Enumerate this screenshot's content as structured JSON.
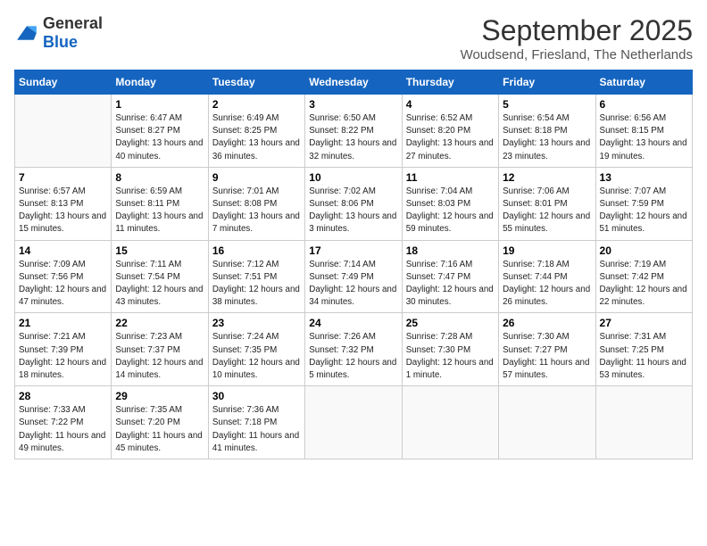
{
  "logo": {
    "text_general": "General",
    "text_blue": "Blue"
  },
  "title": "September 2025",
  "location": "Woudsend, Friesland, The Netherlands",
  "days_of_week": [
    "Sunday",
    "Monday",
    "Tuesday",
    "Wednesday",
    "Thursday",
    "Friday",
    "Saturday"
  ],
  "weeks": [
    [
      {
        "day": "",
        "sunrise": "",
        "sunset": "",
        "daylight": ""
      },
      {
        "day": "1",
        "sunrise": "Sunrise: 6:47 AM",
        "sunset": "Sunset: 8:27 PM",
        "daylight": "Daylight: 13 hours and 40 minutes."
      },
      {
        "day": "2",
        "sunrise": "Sunrise: 6:49 AM",
        "sunset": "Sunset: 8:25 PM",
        "daylight": "Daylight: 13 hours and 36 minutes."
      },
      {
        "day": "3",
        "sunrise": "Sunrise: 6:50 AM",
        "sunset": "Sunset: 8:22 PM",
        "daylight": "Daylight: 13 hours and 32 minutes."
      },
      {
        "day": "4",
        "sunrise": "Sunrise: 6:52 AM",
        "sunset": "Sunset: 8:20 PM",
        "daylight": "Daylight: 13 hours and 27 minutes."
      },
      {
        "day": "5",
        "sunrise": "Sunrise: 6:54 AM",
        "sunset": "Sunset: 8:18 PM",
        "daylight": "Daylight: 13 hours and 23 minutes."
      },
      {
        "day": "6",
        "sunrise": "Sunrise: 6:56 AM",
        "sunset": "Sunset: 8:15 PM",
        "daylight": "Daylight: 13 hours and 19 minutes."
      }
    ],
    [
      {
        "day": "7",
        "sunrise": "Sunrise: 6:57 AM",
        "sunset": "Sunset: 8:13 PM",
        "daylight": "Daylight: 13 hours and 15 minutes."
      },
      {
        "day": "8",
        "sunrise": "Sunrise: 6:59 AM",
        "sunset": "Sunset: 8:11 PM",
        "daylight": "Daylight: 13 hours and 11 minutes."
      },
      {
        "day": "9",
        "sunrise": "Sunrise: 7:01 AM",
        "sunset": "Sunset: 8:08 PM",
        "daylight": "Daylight: 13 hours and 7 minutes."
      },
      {
        "day": "10",
        "sunrise": "Sunrise: 7:02 AM",
        "sunset": "Sunset: 8:06 PM",
        "daylight": "Daylight: 13 hours and 3 minutes."
      },
      {
        "day": "11",
        "sunrise": "Sunrise: 7:04 AM",
        "sunset": "Sunset: 8:03 PM",
        "daylight": "Daylight: 12 hours and 59 minutes."
      },
      {
        "day": "12",
        "sunrise": "Sunrise: 7:06 AM",
        "sunset": "Sunset: 8:01 PM",
        "daylight": "Daylight: 12 hours and 55 minutes."
      },
      {
        "day": "13",
        "sunrise": "Sunrise: 7:07 AM",
        "sunset": "Sunset: 7:59 PM",
        "daylight": "Daylight: 12 hours and 51 minutes."
      }
    ],
    [
      {
        "day": "14",
        "sunrise": "Sunrise: 7:09 AM",
        "sunset": "Sunset: 7:56 PM",
        "daylight": "Daylight: 12 hours and 47 minutes."
      },
      {
        "day": "15",
        "sunrise": "Sunrise: 7:11 AM",
        "sunset": "Sunset: 7:54 PM",
        "daylight": "Daylight: 12 hours and 43 minutes."
      },
      {
        "day": "16",
        "sunrise": "Sunrise: 7:12 AM",
        "sunset": "Sunset: 7:51 PM",
        "daylight": "Daylight: 12 hours and 38 minutes."
      },
      {
        "day": "17",
        "sunrise": "Sunrise: 7:14 AM",
        "sunset": "Sunset: 7:49 PM",
        "daylight": "Daylight: 12 hours and 34 minutes."
      },
      {
        "day": "18",
        "sunrise": "Sunrise: 7:16 AM",
        "sunset": "Sunset: 7:47 PM",
        "daylight": "Daylight: 12 hours and 30 minutes."
      },
      {
        "day": "19",
        "sunrise": "Sunrise: 7:18 AM",
        "sunset": "Sunset: 7:44 PM",
        "daylight": "Daylight: 12 hours and 26 minutes."
      },
      {
        "day": "20",
        "sunrise": "Sunrise: 7:19 AM",
        "sunset": "Sunset: 7:42 PM",
        "daylight": "Daylight: 12 hours and 22 minutes."
      }
    ],
    [
      {
        "day": "21",
        "sunrise": "Sunrise: 7:21 AM",
        "sunset": "Sunset: 7:39 PM",
        "daylight": "Daylight: 12 hours and 18 minutes."
      },
      {
        "day": "22",
        "sunrise": "Sunrise: 7:23 AM",
        "sunset": "Sunset: 7:37 PM",
        "daylight": "Daylight: 12 hours and 14 minutes."
      },
      {
        "day": "23",
        "sunrise": "Sunrise: 7:24 AM",
        "sunset": "Sunset: 7:35 PM",
        "daylight": "Daylight: 12 hours and 10 minutes."
      },
      {
        "day": "24",
        "sunrise": "Sunrise: 7:26 AM",
        "sunset": "Sunset: 7:32 PM",
        "daylight": "Daylight: 12 hours and 5 minutes."
      },
      {
        "day": "25",
        "sunrise": "Sunrise: 7:28 AM",
        "sunset": "Sunset: 7:30 PM",
        "daylight": "Daylight: 12 hours and 1 minute."
      },
      {
        "day": "26",
        "sunrise": "Sunrise: 7:30 AM",
        "sunset": "Sunset: 7:27 PM",
        "daylight": "Daylight: 11 hours and 57 minutes."
      },
      {
        "day": "27",
        "sunrise": "Sunrise: 7:31 AM",
        "sunset": "Sunset: 7:25 PM",
        "daylight": "Daylight: 11 hours and 53 minutes."
      }
    ],
    [
      {
        "day": "28",
        "sunrise": "Sunrise: 7:33 AM",
        "sunset": "Sunset: 7:22 PM",
        "daylight": "Daylight: 11 hours and 49 minutes."
      },
      {
        "day": "29",
        "sunrise": "Sunrise: 7:35 AM",
        "sunset": "Sunset: 7:20 PM",
        "daylight": "Daylight: 11 hours and 45 minutes."
      },
      {
        "day": "30",
        "sunrise": "Sunrise: 7:36 AM",
        "sunset": "Sunset: 7:18 PM",
        "daylight": "Daylight: 11 hours and 41 minutes."
      },
      {
        "day": "",
        "sunrise": "",
        "sunset": "",
        "daylight": ""
      },
      {
        "day": "",
        "sunrise": "",
        "sunset": "",
        "daylight": ""
      },
      {
        "day": "",
        "sunrise": "",
        "sunset": "",
        "daylight": ""
      },
      {
        "day": "",
        "sunrise": "",
        "sunset": "",
        "daylight": ""
      }
    ]
  ]
}
